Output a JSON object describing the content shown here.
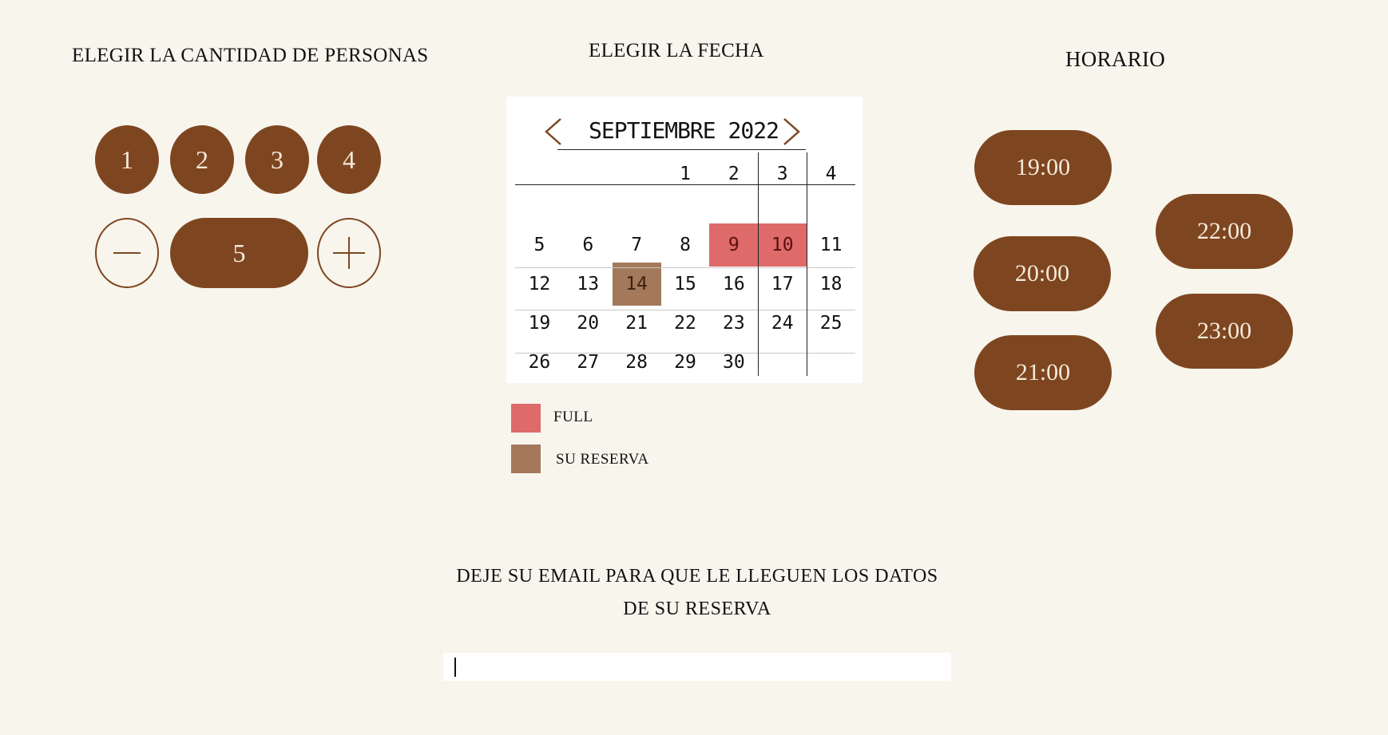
{
  "headings": {
    "people": "ELEGIR LA CANTIDAD DE PERSONAS",
    "date": "ELEGIR LA FECHA",
    "schedule": "HORARIO"
  },
  "people": {
    "options": [
      "1",
      "2",
      "3",
      "4"
    ],
    "count": "5"
  },
  "calendar": {
    "title": "SEPTIEMBRE 2022",
    "weeks": [
      [
        "",
        "",
        "",
        "1",
        "2",
        "3",
        "4"
      ],
      [
        "5",
        "6",
        "7",
        "8",
        "9",
        "10",
        "11"
      ],
      [
        "12",
        "13",
        "14",
        "15",
        "16",
        "17",
        "18"
      ],
      [
        "19",
        "20",
        "21",
        "22",
        "23",
        "24",
        "25"
      ],
      [
        "26",
        "27",
        "28",
        "29",
        "30",
        "",
        ""
      ]
    ],
    "full_days": [
      "9",
      "10"
    ],
    "reserved_days": [
      "14"
    ]
  },
  "legend": {
    "full_label": "FULL",
    "full_color": "#de6a6a",
    "reserved_label": "SU RESERVA",
    "reserved_color": "#a4785a"
  },
  "times": {
    "t1900": "19:00",
    "t2000": "20:00",
    "t2100": "21:00",
    "t2200": "22:00",
    "t2300": "23:00"
  },
  "email": {
    "line1": "DEJE SU EMAIL PARA QUE LE LLEGUEN LOS DATOS",
    "line2": "DE SU RESERVA",
    "value": ""
  },
  "colors": {
    "accent": "#7e4620",
    "background": "#f8f5ed"
  }
}
